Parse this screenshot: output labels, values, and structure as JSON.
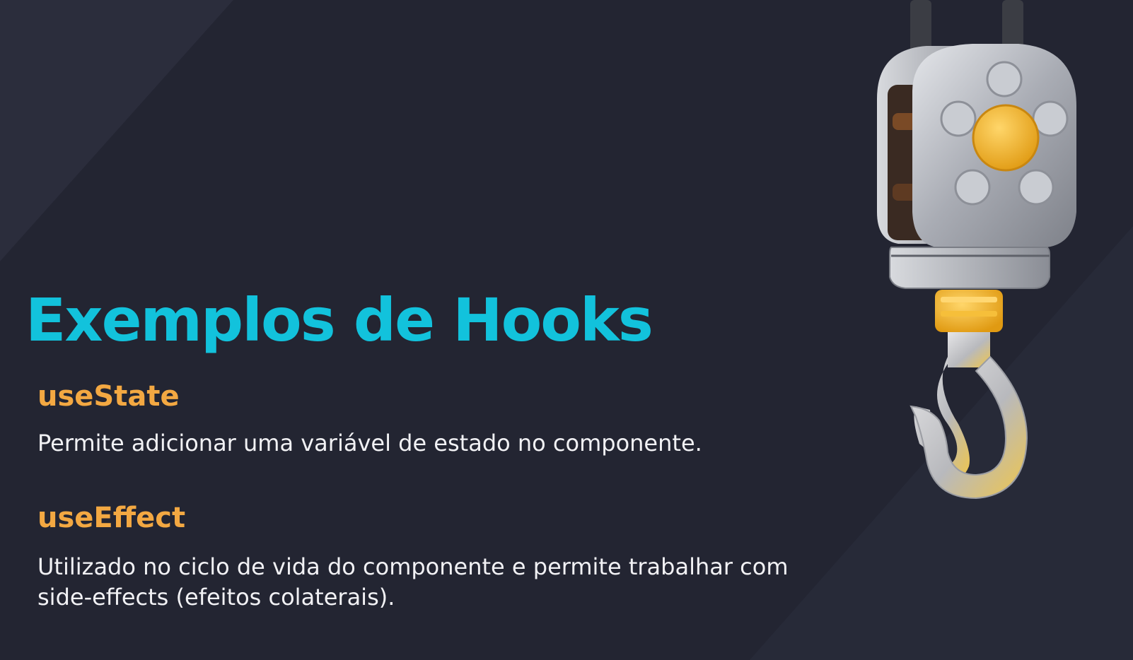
{
  "slide": {
    "title": "Exemplos de Hooks",
    "hooks": [
      {
        "name": "useState",
        "description": "Permite adicionar uma variável de estado no componente."
      },
      {
        "name": "useEffect",
        "description": "Utilizado no ciclo de vida do componente e permite trabalhar com side-effects (efeitos colaterais)."
      }
    ]
  },
  "colors": {
    "background": "#262836",
    "title": "#12c2dc",
    "hook_name": "#f3a842",
    "description": "#f1f1f4",
    "metal": "#b9bcc4",
    "gold": "#f5b82e"
  },
  "illustration": {
    "icon": "crane-hook-pulley-icon"
  }
}
